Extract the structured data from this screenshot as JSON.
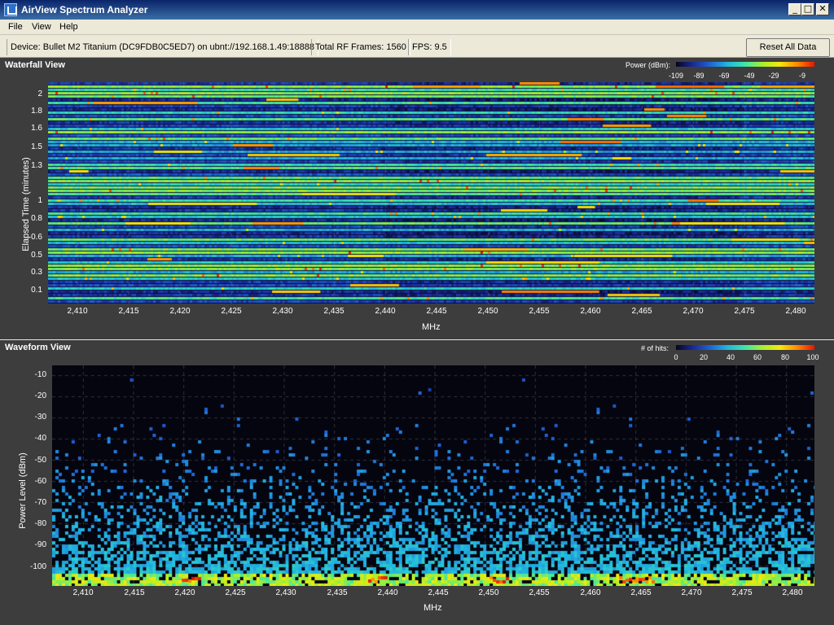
{
  "window": {
    "title": "AirView Spectrum Analyzer",
    "min": "_",
    "max": "□",
    "close": "✕"
  },
  "menu": [
    "File",
    "View",
    "Help"
  ],
  "status": {
    "device": "Device: Bullet M2 Titanium (DC9FDB0C5ED7) on ubnt://192.168.1.49:18888",
    "frames": "Total RF Frames: 1560",
    "fps": "FPS: 9.5",
    "reset_label": "Reset All Data"
  },
  "waterfall": {
    "title": "Waterfall View",
    "legend_label": "Power (dBm):",
    "legend_ticks": [
      "-109",
      "-89",
      "-69",
      "-49",
      "-29",
      "-9"
    ],
    "y_ticks": [
      "2",
      "1.8",
      "1.6",
      "1.5",
      "1.3",
      "1",
      "0.8",
      "0.6",
      "0.5",
      "0.3",
      "0.1"
    ],
    "y_label": "Elapsed Time (minutes)",
    "x_ticks": [
      "2,410",
      "2,415",
      "2,420",
      "2,425",
      "2,430",
      "2,435",
      "2,440",
      "2,445",
      "2,450",
      "2,455",
      "2,460",
      "2,465",
      "2,470",
      "2,475",
      "2,480"
    ],
    "x_label": "MHz"
  },
  "waveform": {
    "title": "Waveform View",
    "legend_label": "# of hits:",
    "legend_ticks": [
      "0",
      "20",
      "40",
      "60",
      "80",
      "100"
    ],
    "y_ticks": [
      "-10",
      "-20",
      "-30",
      "-40",
      "-50",
      "-60",
      "-70",
      "-80",
      "-90",
      "-100"
    ],
    "y_label": "Power Level (dBm)",
    "x_ticks": [
      "2,410",
      "2,415",
      "2,420",
      "2,425",
      "2,430",
      "2,435",
      "2,440",
      "2,445",
      "2,450",
      "2,455",
      "2,460",
      "2,465",
      "2,470",
      "2,475",
      "2,480"
    ],
    "x_label": "MHz"
  },
  "colors": {
    "panel_bg": "#3d3d3d",
    "plot_bg": "#050510",
    "accent": "#0a246a"
  }
}
